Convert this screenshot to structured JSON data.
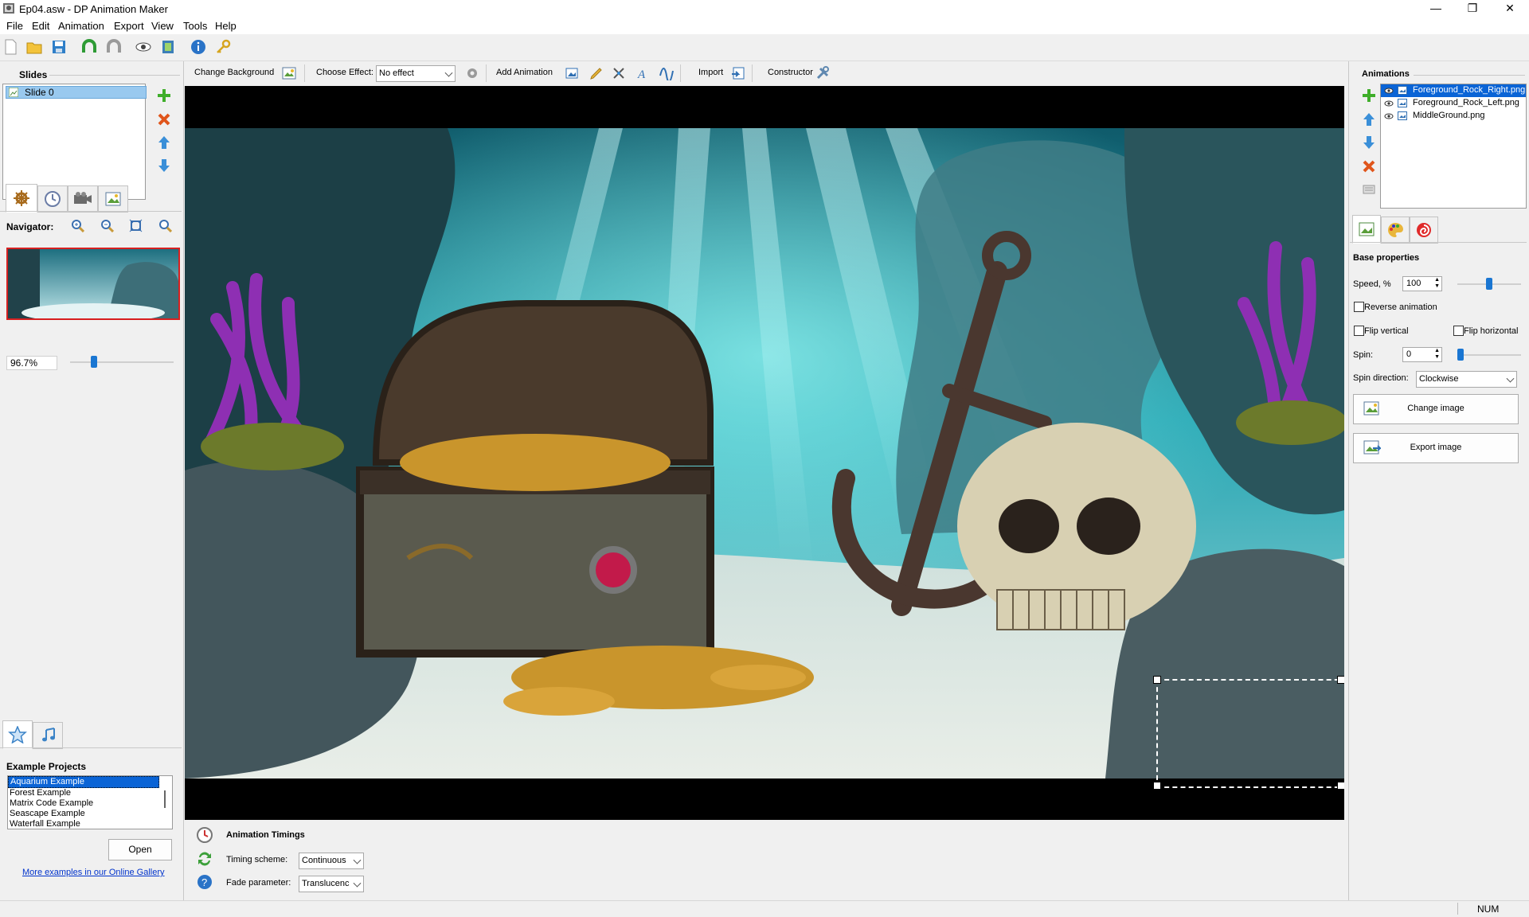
{
  "window": {
    "title": "Ep04.asw - DP Animation Maker",
    "minimize": "—",
    "maximize": "❐",
    "close": "✕"
  },
  "menu": [
    "File",
    "Edit",
    "Animation",
    "Export",
    "View",
    "Tools",
    "Help"
  ],
  "effects_toolbar": {
    "change_background": "Change Background",
    "choose_effect_label": "Choose Effect:",
    "effect_value": "No effect",
    "add_animation": "Add Animation",
    "import": "Import",
    "constructor": "Constructor"
  },
  "slides": {
    "title": "Slides",
    "items": [
      "Slide 0"
    ]
  },
  "navigator": {
    "label": "Navigator:",
    "zoom": "96.7%"
  },
  "examples": {
    "title": "Example Projects",
    "items": [
      "Aquarium Example",
      "Forest Example",
      "Matrix Code Example",
      "Seascape Example",
      "Waterfall Example"
    ],
    "selected": 0,
    "open_button": "Open",
    "gallery_link": "More examples in our Online Gallery"
  },
  "timings": {
    "title": "Animation Timings",
    "scheme_label": "Timing scheme:",
    "scheme_value": "Continuous",
    "fade_label": "Fade parameter:",
    "fade_value": "Translucenc"
  },
  "animations": {
    "title": "Animations",
    "items": [
      "Foreground_Rock_Right.png",
      "Foreground_Rock_Left.png",
      "MiddleGround.png"
    ],
    "selected": 0
  },
  "properties": {
    "title": "Base properties",
    "speed_label": "Speed, %",
    "speed_value": "100",
    "speed_level": 0.5,
    "reverse_label": "Reverse animation",
    "flip_vertical_label": "Flip vertical",
    "flip_horizontal_label": "Flip horizontal",
    "spin_label": "Spin:",
    "spin_value": "0",
    "spin_level": 0.0,
    "spin_direction_label": "Spin direction:",
    "spin_direction_value": "Clockwise",
    "change_image": "Change image",
    "export_image": "Export image"
  },
  "status": {
    "num": "NUM"
  },
  "colors": {
    "selection": "#99c9ef",
    "accent": "#1a76d2",
    "canvas": "#000000"
  }
}
